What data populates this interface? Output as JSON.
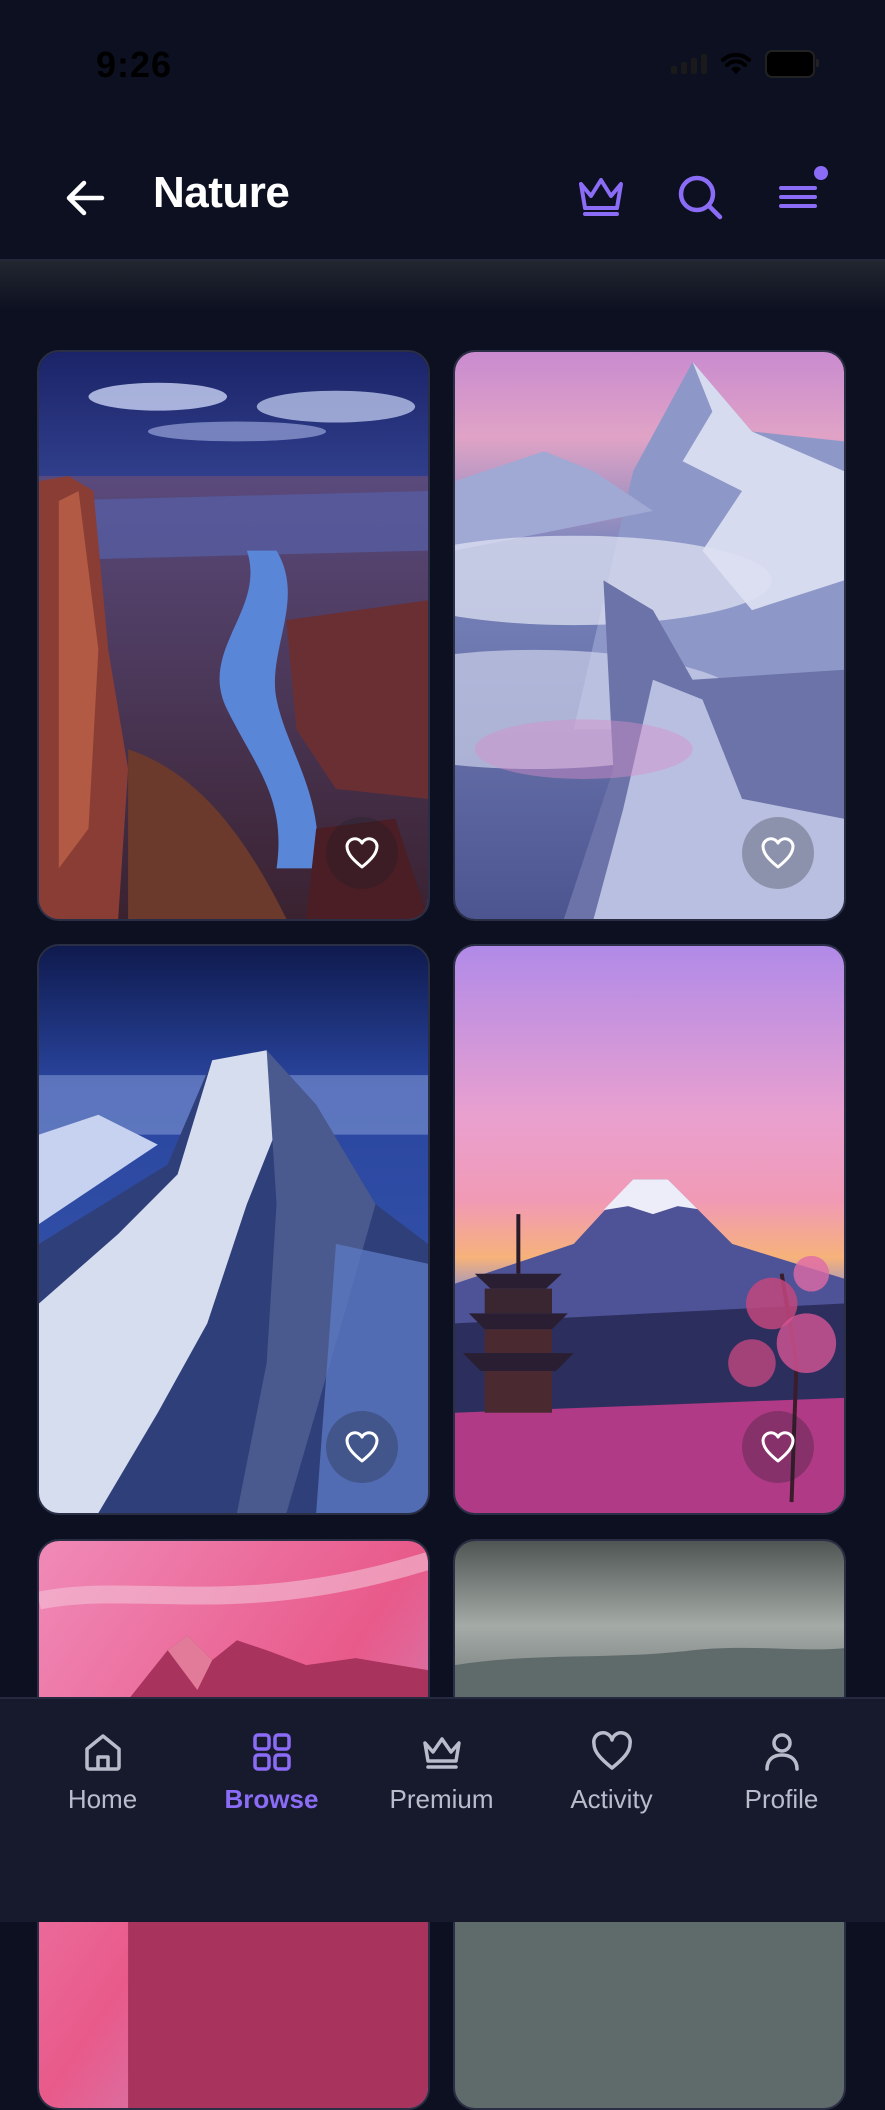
{
  "status_bar": {
    "time": "9:26"
  },
  "header": {
    "title": "Nature"
  },
  "grid": {
    "items": [
      {
        "scene": "canyon"
      },
      {
        "scene": "snow-peaks"
      },
      {
        "scene": "blue-summit"
      },
      {
        "scene": "fuji-pagoda"
      },
      {
        "scene": "pink-rocks"
      },
      {
        "scene": "cloudy-hills"
      }
    ]
  },
  "tabbar": {
    "items": [
      {
        "label": "Home",
        "icon": "home-icon"
      },
      {
        "label": "Browse",
        "icon": "grid-icon",
        "active": true
      },
      {
        "label": "Premium",
        "icon": "crown-icon"
      },
      {
        "label": "Activity",
        "icon": "heart-icon"
      },
      {
        "label": "Profile",
        "icon": "person-icon"
      }
    ]
  },
  "colors": {
    "accent": "#8b6cf6",
    "background": "#0d1020",
    "tabbar": "#171a2c"
  }
}
